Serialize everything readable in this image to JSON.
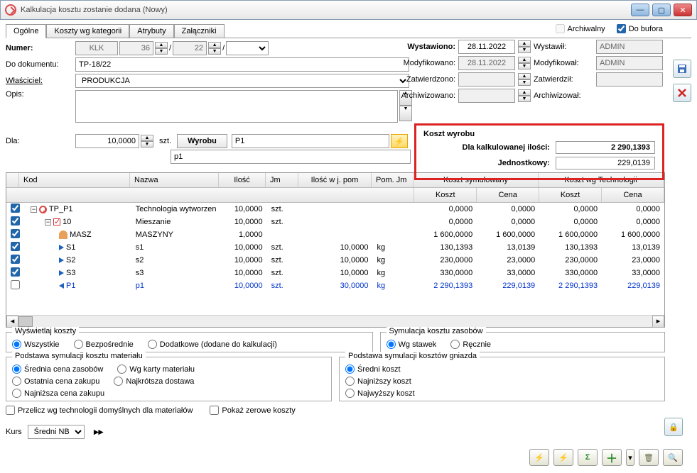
{
  "window": {
    "title": "Kalkulacja kosztu zostanie dodana  (Nowy)"
  },
  "topchecks": {
    "archiwalny": "Archiwalny",
    "dobufora": "Do bufora"
  },
  "tabs": [
    "Ogólne",
    "Koszty wg kategorii",
    "Atrybuty",
    "Załączniki"
  ],
  "form": {
    "numer_l": "Numer:",
    "numer_klk": "KLK",
    "numer_n1": "36",
    "numer_n2": "22",
    "dokument_l": "Do dokumentu:",
    "dokument_v": "TP-18/22",
    "wlasciciel_l": "Właściciel:",
    "wlasciciel_v": "PRODUKCJA",
    "opis_l": "Opis:",
    "dla_l": "Dla:",
    "dla_v": "10,0000",
    "dla_jm": "szt.",
    "wyrobu_l": "Wyrobu",
    "wyrobu_v": "P1",
    "wyrobu_desc": "p1"
  },
  "right": {
    "wystawiono_l": "Wystawiono:",
    "wystawiono_v": "28.11.2022",
    "wystawil_l": "Wystawił:",
    "wystawil_v": "ADMIN",
    "modyf_l": "Modyfikowano:",
    "modyf_v": "28.11.2022",
    "modyfikowal_l": "Modyfikował:",
    "modyfikowal_v": "ADMIN",
    "zatw_l": "Zatwierdzono:",
    "zatw_v": "",
    "zatwierdzil_l": "Zatwierdził:",
    "zatwierdzil_v": "",
    "arch_l": "Archiwizowano:",
    "arch_v": "",
    "archiwizowal_l": "Archiwizował:"
  },
  "koszt": {
    "head": "Koszt wyrobu",
    "dla_l": "Dla kalkulowanej ilości:",
    "dla_v": "2 290,1393",
    "jedn_l": "Jednostkowy:",
    "jedn_v": "229,0139"
  },
  "grid": {
    "h": {
      "kod": "Kod",
      "nazwa": "Nazwa",
      "ilosc": "Ilość",
      "jm": "Jm",
      "iloscp": "Ilość w j. pom",
      "pomjm": "Pom. Jm",
      "ksym": "Koszt symulowany",
      "ktech": "Koszt wg Technologii",
      "koszt": "Koszt",
      "cena": "Cena"
    },
    "rows": [
      {
        "chk": true,
        "indent": 0,
        "icon": "circ",
        "kod": "TP_P1",
        "nazwa": "Technologia wytworzen",
        "il": "10,0000",
        "jm": "szt.",
        "ilp": "",
        "pjm": "",
        "k1": "0,0000",
        "c1": "0,0000",
        "k2": "0,0000",
        "c2": "0,0000"
      },
      {
        "chk": true,
        "indent": 1,
        "icon": "redcheck",
        "kod": "10",
        "nazwa": "Mieszanie",
        "il": "10,0000",
        "jm": "szt.",
        "ilp": "",
        "pjm": "",
        "k1": "0,0000",
        "c1": "0,0000",
        "k2": "0,0000",
        "c2": "0,0000"
      },
      {
        "chk": true,
        "indent": 2,
        "icon": "person",
        "kod": "MASZ",
        "nazwa": "MASZYNY",
        "il": "1,0000",
        "jm": "",
        "ilp": "",
        "pjm": "",
        "k1": "1 600,0000",
        "c1": "1 600,0000",
        "k2": "1 600,0000",
        "c2": "1 600,0000"
      },
      {
        "chk": true,
        "indent": 2,
        "icon": "arrow-r",
        "kod": "S1",
        "nazwa": "s1",
        "il": "10,0000",
        "jm": "szt.",
        "ilp": "10,0000",
        "pjm": "kg",
        "k1": "130,1393",
        "c1": "13,0139",
        "k2": "130,1393",
        "c2": "13,0139"
      },
      {
        "chk": true,
        "indent": 2,
        "icon": "arrow-r",
        "kod": "S2",
        "nazwa": "s2",
        "il": "10,0000",
        "jm": "szt.",
        "ilp": "10,0000",
        "pjm": "kg",
        "k1": "230,0000",
        "c1": "23,0000",
        "k2": "230,0000",
        "c2": "23,0000"
      },
      {
        "chk": true,
        "indent": 2,
        "icon": "arrow-r",
        "kod": "S3",
        "nazwa": "s3",
        "il": "10,0000",
        "jm": "szt.",
        "ilp": "10,0000",
        "pjm": "kg",
        "k1": "330,0000",
        "c1": "33,0000",
        "k2": "330,0000",
        "c2": "33,0000"
      },
      {
        "chk": false,
        "indent": 2,
        "icon": "arrow-l",
        "kod": "P1",
        "nazwa": "p1",
        "il": "10,0000",
        "jm": "szt.",
        "ilp": "30,0000",
        "pjm": "kg",
        "k1": "2 290,1393",
        "c1": "229,0139",
        "k2": "2 290,1393",
        "c2": "229,0139",
        "blue": true
      }
    ]
  },
  "groups": {
    "wysw_l": "Wyświetlaj koszty",
    "wysw": [
      "Wszystkie",
      "Bezpośrednie",
      "Dodatkowe (dodane do kalkulacji)"
    ],
    "sym_l": "Symulacja kosztu zasobów",
    "sym": [
      "Wg stawek",
      "Ręcznie"
    ],
    "mat_l": "Podstawa symulacji kosztu materiału",
    "mat": [
      "Średnia cena zasobów",
      "Wg karty materiału",
      "Ostatnia cena zakupu",
      "Najkrótsza dostawa",
      "Najniższa cena zakupu"
    ],
    "gni_l": "Podstawa symulacji kosztów gniazda",
    "gni": [
      "Średni koszt",
      "Najniższy koszt",
      "Najwyższy koszt"
    ],
    "przelicz": "Przelicz wg technologii domyślnych dla materiałów",
    "pokaz": "Pokaż zerowe koszty"
  },
  "kurs": {
    "l": "Kurs",
    "v": "Średni NBP"
  }
}
